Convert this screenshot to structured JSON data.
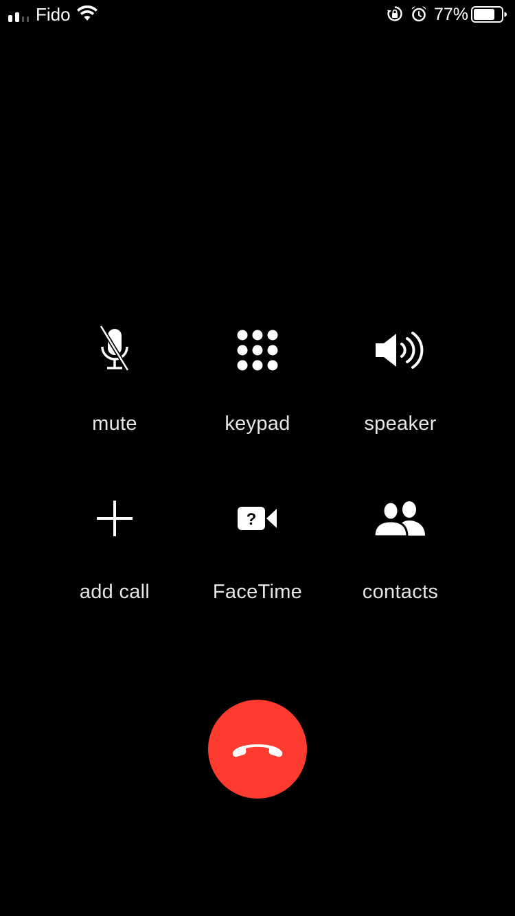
{
  "status_bar": {
    "carrier": "Fido",
    "battery_percent": "77%",
    "battery_level": 0.77,
    "icons": [
      "signal-icon",
      "wifi-icon",
      "rotation-lock-icon",
      "alarm-icon",
      "battery-icon"
    ]
  },
  "call_controls": {
    "mute": {
      "label": "mute",
      "icon": "mute-microphone-icon"
    },
    "keypad": {
      "label": "keypad",
      "icon": "keypad-icon"
    },
    "speaker": {
      "label": "speaker",
      "icon": "speaker-icon"
    },
    "add_call": {
      "label": "add call",
      "icon": "plus-icon"
    },
    "facetime": {
      "label": "FaceTime",
      "icon": "facetime-video-icon"
    },
    "contacts": {
      "label": "contacts",
      "icon": "contacts-icon"
    }
  },
  "end_call": {
    "icon": "end-call-icon",
    "color": "#ff3b30"
  },
  "colors": {
    "background": "#000000",
    "foreground": "#ffffff",
    "end_call": "#ff3b30"
  }
}
